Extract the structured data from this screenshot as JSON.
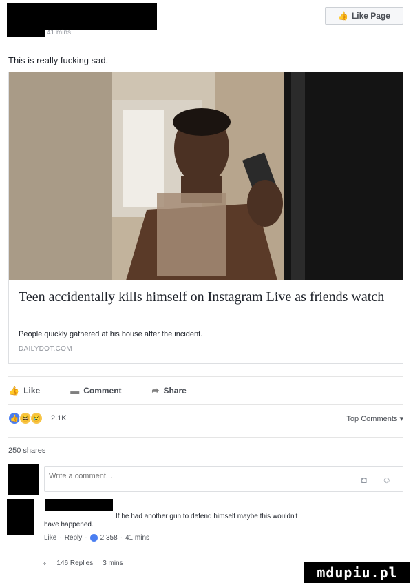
{
  "post": {
    "meta_time": "41 mins",
    "like_page": "Like Page",
    "text": "This is really fucking sad."
  },
  "link": {
    "title": "Teen accidentally kills himself on Instagram Live as friends watch",
    "description": "People quickly gathered at his house after the incident.",
    "domain": "DAILYDOT.COM"
  },
  "actions": {
    "like": "Like",
    "comment": "Comment",
    "share": "Share"
  },
  "reactions": {
    "count": "2.1K",
    "top_comments": "Top Comments"
  },
  "shares": "250 shares",
  "composer": {
    "placeholder": "Write a comment..."
  },
  "comment": {
    "text_line1": "If he had another gun to defend himself maybe this wouldn't",
    "text_line2": "have happened.",
    "like": "Like",
    "reply": "Reply",
    "like_count": "2,358",
    "time": "41 mins"
  },
  "replies": {
    "label": "146 Replies",
    "time": "3 mins"
  },
  "watermark": "mdupiu.pl",
  "colors": {
    "accent": "#4a7ef1",
    "text": "#1d2129",
    "muted": "#90949c"
  }
}
